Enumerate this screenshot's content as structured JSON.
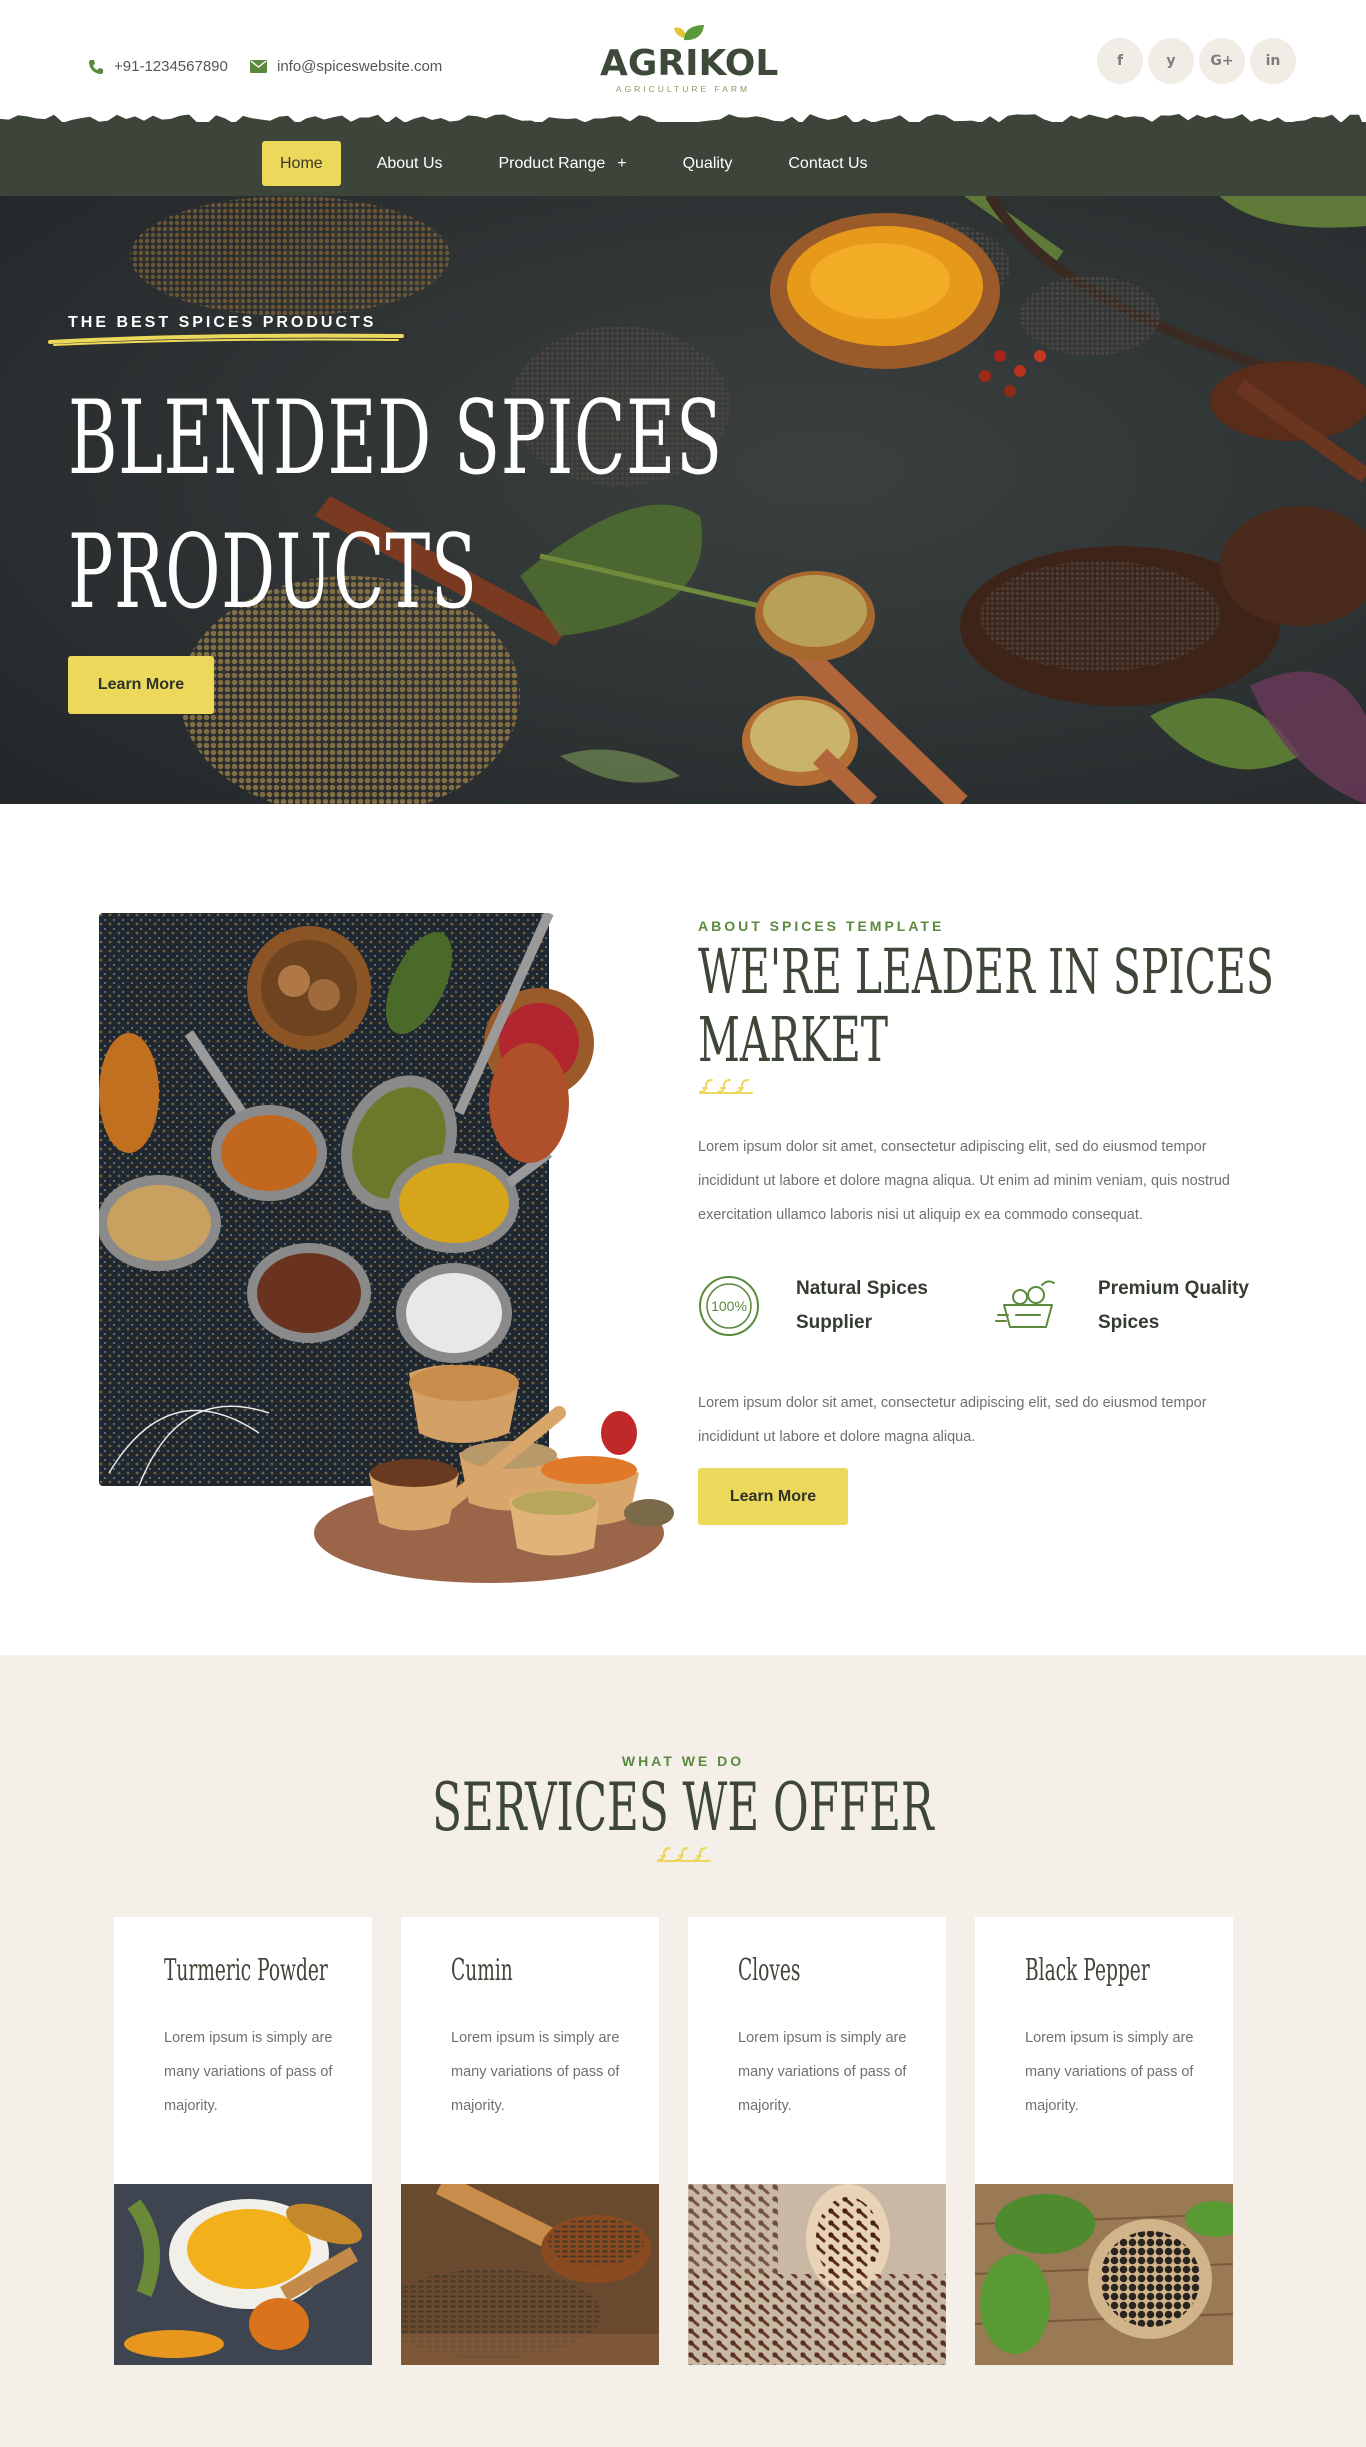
{
  "header": {
    "phone": "+91-1234567890",
    "email": "info@spiceswebsite.com",
    "logo_name": "AGRIKOL",
    "logo_tagline": "AGRICULTURE FARM",
    "socials": [
      {
        "icon": "facebook-icon",
        "glyph": "f"
      },
      {
        "icon": "twitter-icon",
        "glyph": "y"
      },
      {
        "icon": "google-plus-icon",
        "glyph": "G+"
      },
      {
        "icon": "linkedin-icon",
        "glyph": "in"
      }
    ]
  },
  "nav": {
    "items": [
      {
        "label": "Home",
        "active": true
      },
      {
        "label": "About Us"
      },
      {
        "label": "Product Range",
        "has_submenu": true,
        "submenu_glyph": "+"
      },
      {
        "label": "Quality"
      },
      {
        "label": "Contact Us"
      }
    ]
  },
  "hero": {
    "kicker": "THE BEST SPICES PRODUCTS",
    "title_line1": "BLENDED SPICES",
    "title_line2": "PRODUCTS",
    "button": "Learn More"
  },
  "about": {
    "kicker": "ABOUT SPICES TEMPLATE",
    "title_line1": "WE'RE LEADER IN SPICES",
    "title_line2": "MARKET",
    "paragraph1": "Lorem ipsum dolor sit amet, consectetur adipiscing elit, sed do eiusmod tempor incididunt ut labore et dolore magna aliqua. Ut enim ad minim veniam, quis nostrud exercitation ullamco laboris nisi ut aliquip ex ea commodo consequat.",
    "features": [
      {
        "icon": "hundred-percent-badge-icon",
        "badge_text": "100%",
        "label": "Natural Spices Supplier"
      },
      {
        "icon": "spice-basket-icon",
        "label": "Premium Quality Spices"
      }
    ],
    "paragraph2": "Lorem ipsum dolor sit amet, consectetur adipiscing elit, sed do eiusmod tempor incididunt ut labore et dolore magna aliqua.",
    "button": "Learn More"
  },
  "services": {
    "kicker": "WHAT WE DO",
    "title": "SERVICES WE OFFER",
    "cards": [
      {
        "title": "Turmeric Powder",
        "text": "Lorem ipsum is simply are many variations of pass of majority.",
        "image": "turmeric-image"
      },
      {
        "title": "Cumin",
        "text": "Lorem ipsum is simply are many variations of pass of majority.",
        "image": "cumin-image"
      },
      {
        "title": "Cloves",
        "text": "Lorem ipsum is simply are many variations of pass of majority.",
        "image": "cloves-image"
      },
      {
        "title": "Black Pepper",
        "text": "Lorem ipsum is simply are many variations of pass of majority.",
        "image": "black-pepper-image"
      }
    ]
  },
  "colors": {
    "nav_bg": "#3d443a",
    "accent_yellow": "#ecd85a",
    "accent_green": "#5b8a3e",
    "heading_dark": "#3d4638",
    "services_bg": "#f4efe8"
  }
}
